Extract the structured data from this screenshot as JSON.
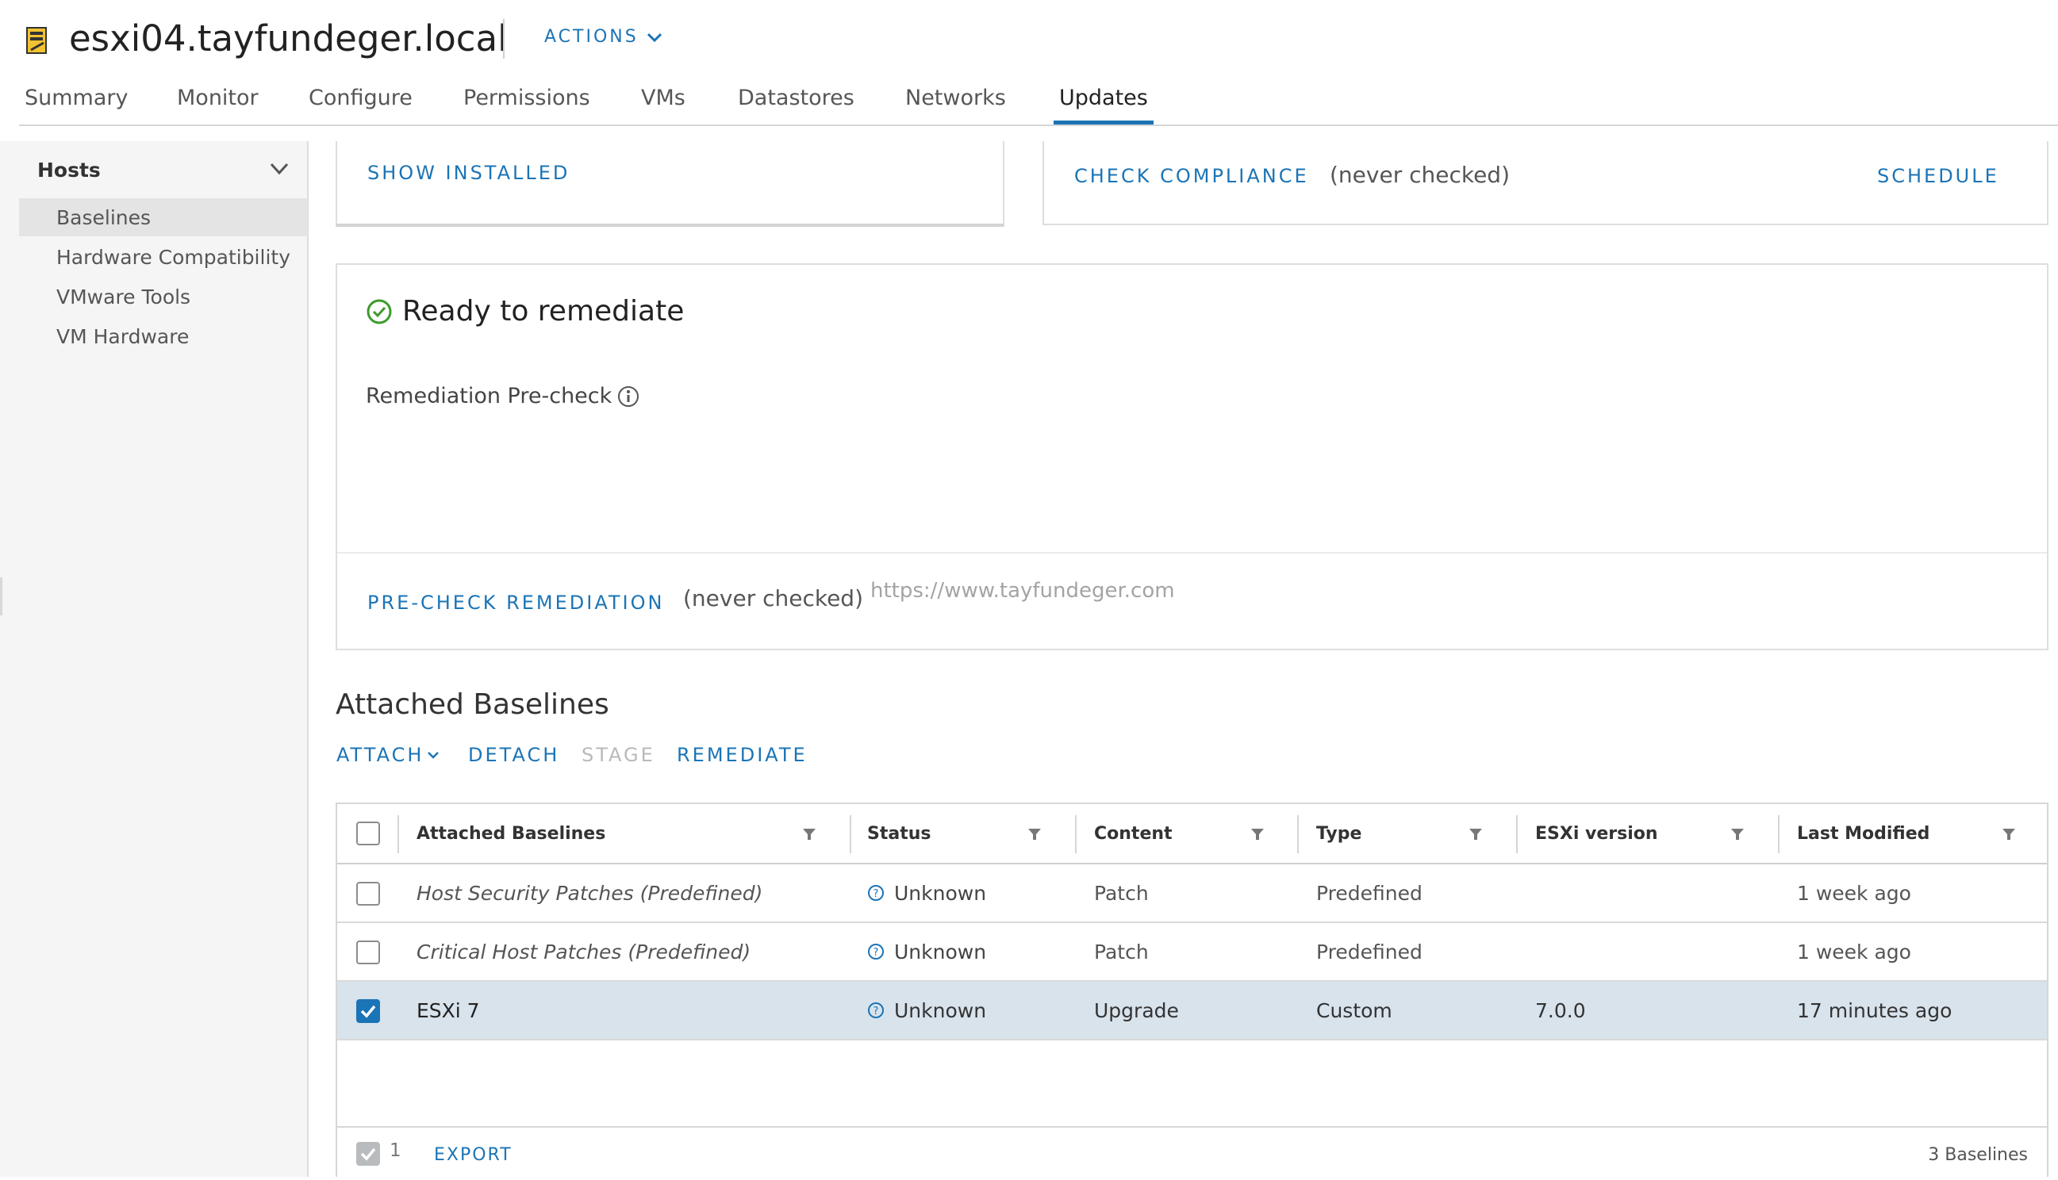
{
  "header": {
    "host_name": "esxi04.tayfundeger.local",
    "actions_label": "ACTIONS"
  },
  "tabs": [
    {
      "label": "Summary"
    },
    {
      "label": "Monitor"
    },
    {
      "label": "Configure"
    },
    {
      "label": "Permissions"
    },
    {
      "label": "VMs"
    },
    {
      "label": "Datastores"
    },
    {
      "label": "Networks"
    },
    {
      "label": "Updates",
      "active": true
    }
  ],
  "sidebar": {
    "section_label": "Hosts",
    "items": [
      {
        "label": "Baselines",
        "selected": true
      },
      {
        "label": "Hardware Compatibility"
      },
      {
        "label": "VMware Tools"
      },
      {
        "label": "VM Hardware"
      }
    ]
  },
  "installed_card": {
    "show_installed_label": "SHOW INSTALLED"
  },
  "compliance_card": {
    "check_compliance_label": "CHECK COMPLIANCE",
    "status": "(never checked)",
    "schedule_label": "SCHEDULE"
  },
  "remediation_card": {
    "title": "Ready to remediate",
    "precheck_label": "Remediation Pre-check",
    "precheck_button": "PRE-CHECK REMEDIATION",
    "precheck_status": "(never checked)",
    "watermark": "https://www.tayfundeger.com"
  },
  "baselines": {
    "title": "Attached Baselines",
    "actions": {
      "attach": "ATTACH",
      "detach": "DETACH",
      "stage": "STAGE",
      "remediate": "REMEDIATE"
    },
    "columns": [
      "Attached Baselines",
      "Status",
      "Content",
      "Type",
      "ESXi version",
      "Last Modified"
    ],
    "rows": [
      {
        "name": "Host Security Patches (Predefined)",
        "status": "Unknown",
        "content": "Patch",
        "type": "Predefined",
        "esxi_version": "",
        "last_modified": "1 week ago",
        "selected": false
      },
      {
        "name": "Critical Host Patches (Predefined)",
        "status": "Unknown",
        "content": "Patch",
        "type": "Predefined",
        "esxi_version": "",
        "last_modified": "1 week ago",
        "selected": false
      },
      {
        "name": "ESXi 7",
        "status": "Unknown",
        "content": "Upgrade",
        "type": "Custom",
        "esxi_version": "7.0.0",
        "last_modified": "17 minutes ago",
        "selected": true
      }
    ],
    "footer": {
      "selected_count": "1",
      "export_label": "EXPORT",
      "total_label": "3 Baselines"
    }
  },
  "colors": {
    "accent": "#1b74b6",
    "success": "#3e9a2c",
    "selected_row": "#d8e3ec",
    "sidebar_bg": "#f5f5f5"
  },
  "icons": {
    "host": "host-icon",
    "ready": "check-circle-icon",
    "info": "info-icon",
    "status": "question-circle-icon",
    "filter": "filter-icon"
  }
}
